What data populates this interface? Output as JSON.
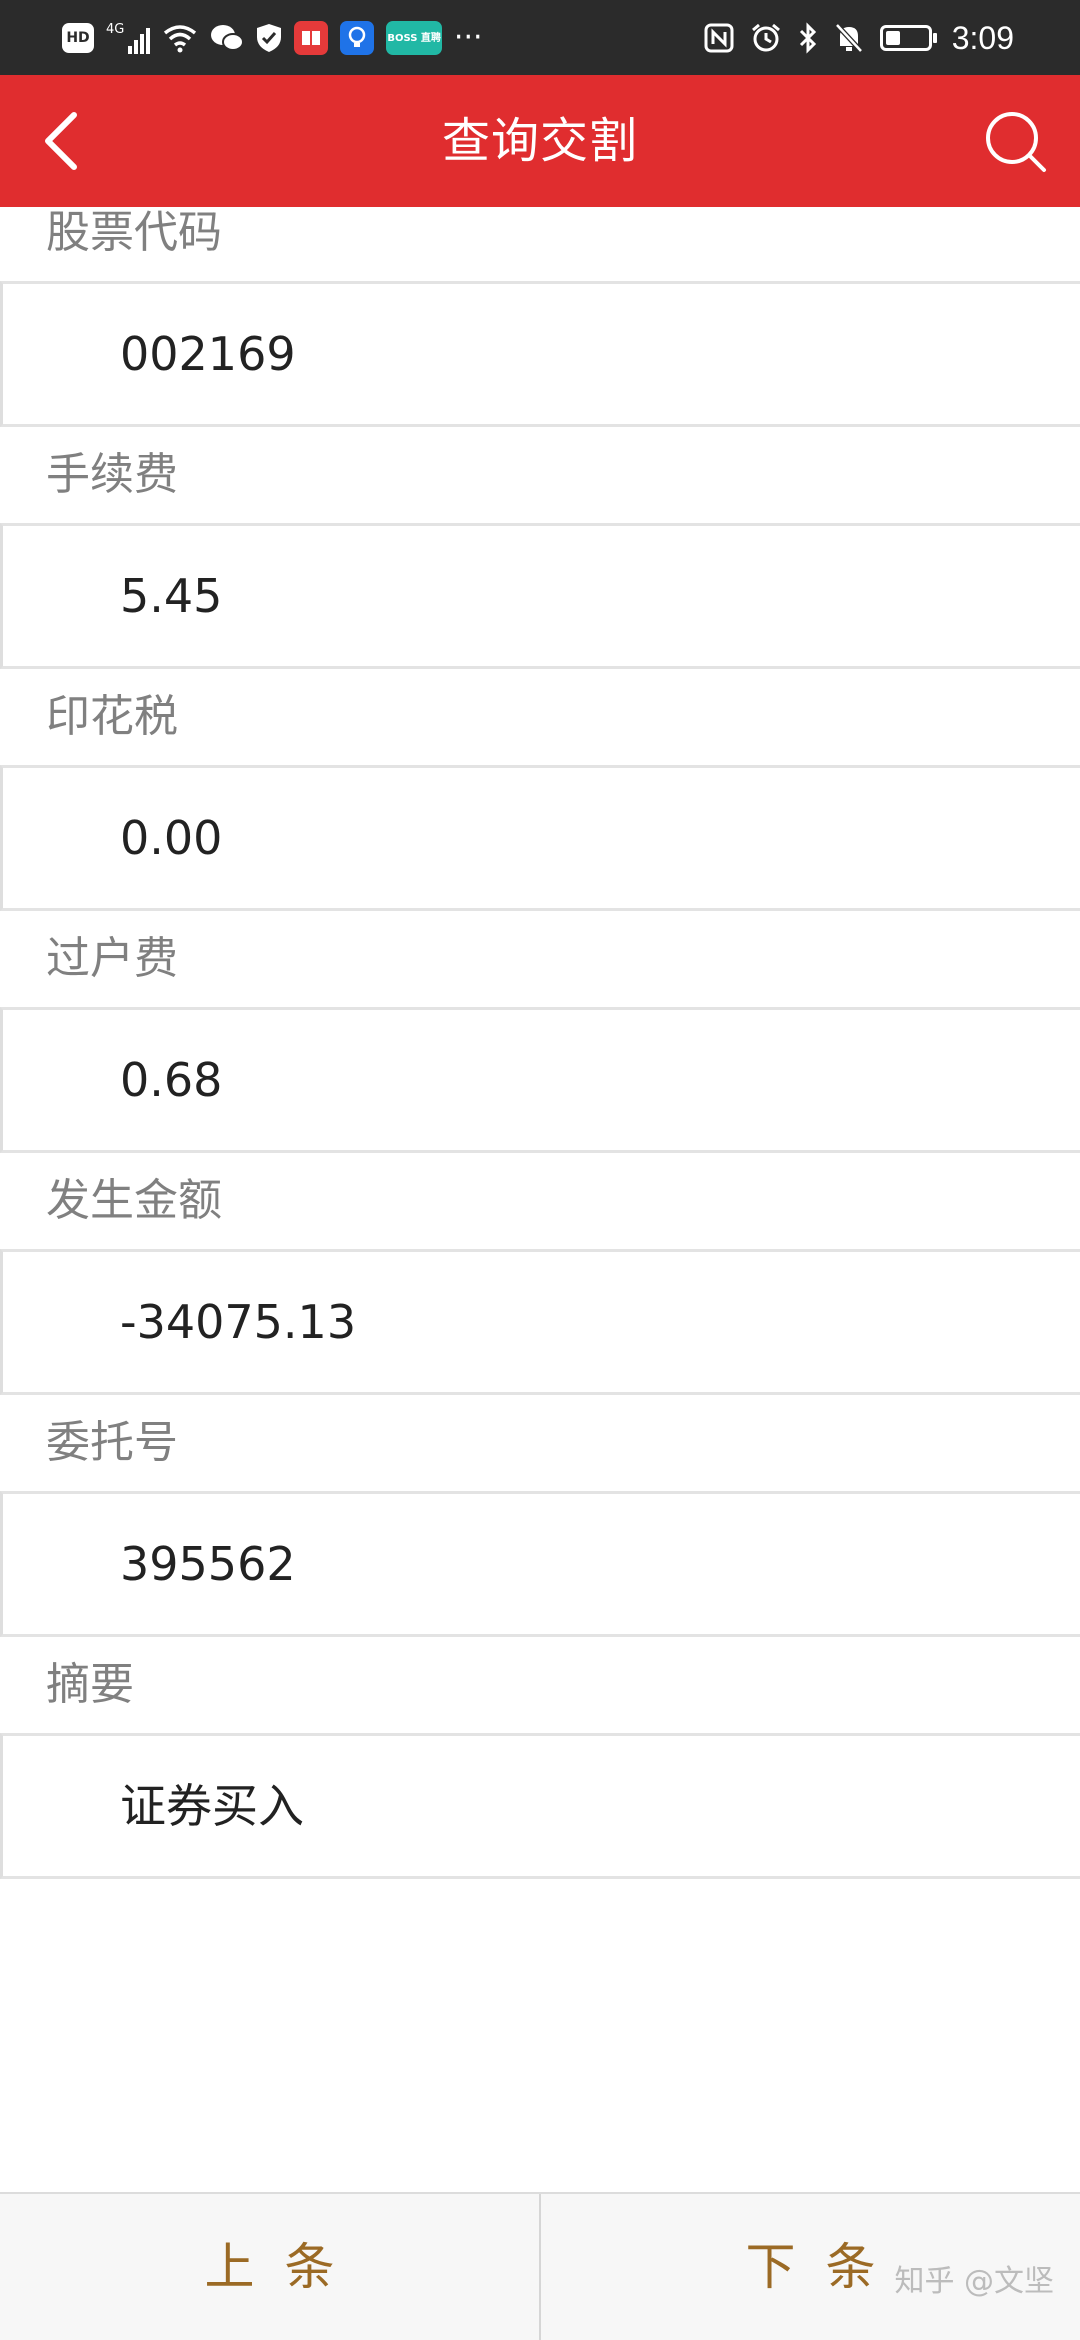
{
  "status_bar": {
    "hd_badge": "HD",
    "network": "4G",
    "boss_label": "BOSS 直聘",
    "more": "···",
    "time": "3:09",
    "battery_level": 0.35
  },
  "header": {
    "title": "查询交割"
  },
  "fields": [
    {
      "label": "股票代码",
      "value": "002169"
    },
    {
      "label": "手续费",
      "value": "5.45"
    },
    {
      "label": "印花税",
      "value": "0.00"
    },
    {
      "label": "过户费",
      "value": "0.68"
    },
    {
      "label": "发生金额",
      "value": "-34075.13"
    },
    {
      "label": "委托号",
      "value": "395562"
    },
    {
      "label": "摘要",
      "value": "证券买入"
    }
  ],
  "footer": {
    "prev_label": "上条",
    "next_label": "下条",
    "watermark": "知乎 @文坚"
  },
  "colors": {
    "header_bg": "#e02d2f",
    "status_bg": "#2b2b2b",
    "footer_text": "#9b6a25"
  }
}
